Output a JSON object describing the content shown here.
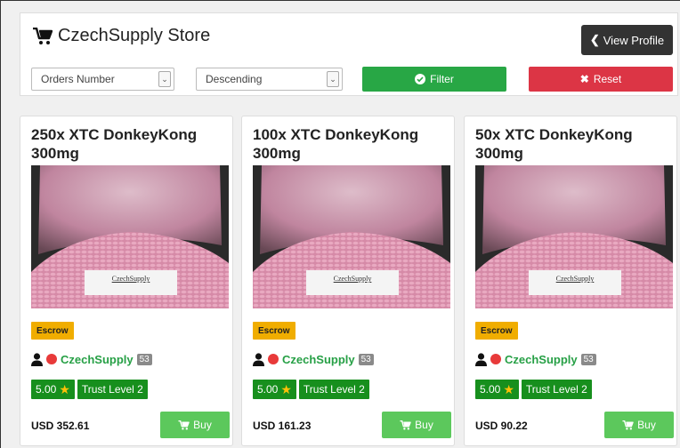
{
  "store": {
    "title": "CzechSupply Store",
    "view_profile_label": "View Profile"
  },
  "filters": {
    "sort_field": "Orders Number",
    "sort_order": "Descending",
    "filter_label": "Filter",
    "reset_label": "Reset"
  },
  "icons": {
    "cart": "cart-icon",
    "chevron": "chevron-left-icon",
    "check": "check-circle-icon",
    "times": "times-icon",
    "user": "user-icon",
    "star": "star-icon"
  },
  "colors": {
    "filter": "#28a745",
    "reset": "#dc3545",
    "escrow": "#f0ad00",
    "trust": "#178f1d",
    "buy": "#5cc85c",
    "vendor": "#27a046"
  },
  "listings": [
    {
      "title": "250x XTC DonkeyKong 300mg",
      "image_label": "CzechSupply",
      "escrow": "Escrow",
      "vendor": "CzechSupply",
      "vendor_count": "53",
      "rating": "5.00",
      "trust": "Trust Level 2",
      "price": "USD 352.61",
      "buy": "Buy"
    },
    {
      "title": "100x XTC DonkeyKong 300mg",
      "image_label": "CzechSupply",
      "escrow": "Escrow",
      "vendor": "CzechSupply",
      "vendor_count": "53",
      "rating": "5.00",
      "trust": "Trust Level 2",
      "price": "USD 161.23",
      "buy": "Buy"
    },
    {
      "title": "50x XTC DonkeyKong 300mg",
      "image_label": "CzechSupply",
      "escrow": "Escrow",
      "vendor": "CzechSupply",
      "vendor_count": "53",
      "rating": "5.00",
      "trust": "Trust Level 2",
      "price": "USD 90.22",
      "buy": "Buy"
    }
  ]
}
